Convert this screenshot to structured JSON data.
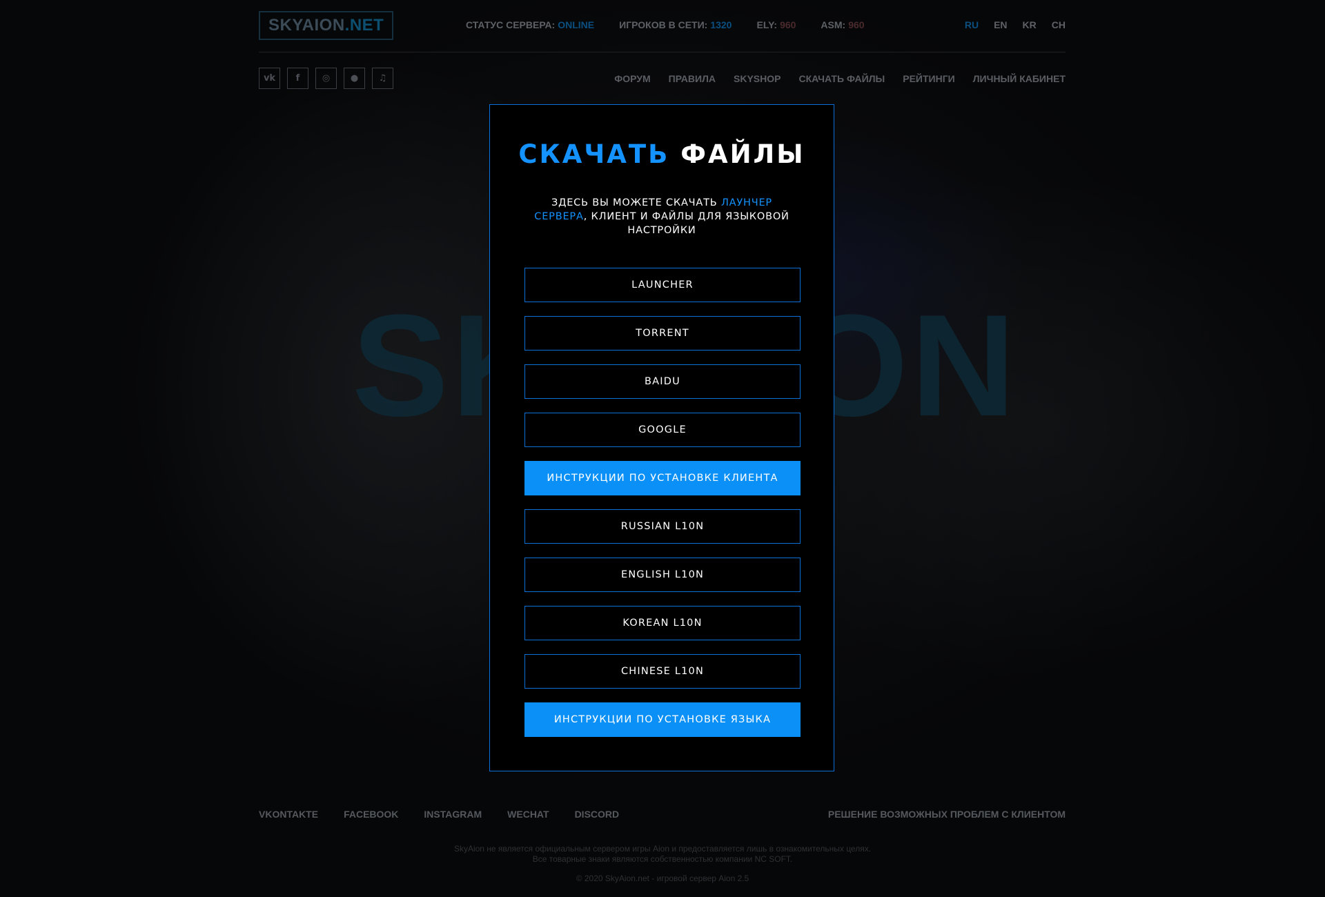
{
  "header": {
    "logo": {
      "main": "SKYAION",
      "suffix": ".NET"
    },
    "stats": [
      {
        "label": "СТАТУС СЕРВЕРА:",
        "value": "ONLINE"
      },
      {
        "label": "ИГРОКОВ В СЕТИ:",
        "value": "1320"
      },
      {
        "label": "ELY:",
        "value": "960"
      },
      {
        "label": "ASM:",
        "value": "960"
      }
    ],
    "languages": [
      "RU",
      "EN",
      "KR",
      "CH"
    ],
    "active_language": "RU"
  },
  "social_icons": [
    "vk-icon",
    "facebook-icon",
    "instagram-icon",
    "wechat-icon",
    "discord-icon"
  ],
  "social_glyphs": [
    "vk",
    "f",
    "◎",
    "●",
    "♫"
  ],
  "nav": [
    "ФОРУМ",
    "ПРАВИЛА",
    "SKYSHOP",
    "СКАЧАТЬ ФАЙЛЫ",
    "РЕЙТИНГИ",
    "ЛИЧНЫЙ КАБИНЕТ"
  ],
  "background_logo": "SKYAION",
  "modal": {
    "title_accent": "СКАЧАТЬ",
    "title_rest": "ФАЙЛЫ",
    "desc_before": "ЗДЕСЬ ВЫ МОЖЕТЕ СКАЧАТЬ ",
    "desc_link": "ЛАУНЧЕР СЕРВЕРА",
    "desc_after": ", КЛИЕНТ И ФАЙЛЫ ДЛЯ ЯЗЫКОВОЙ НАСТРОЙКИ",
    "buttons": [
      {
        "label": "LAUNCHER",
        "primary": false
      },
      {
        "label": "TORRENT",
        "primary": false
      },
      {
        "label": "BAIDU",
        "primary": false
      },
      {
        "label": "GOOGLE",
        "primary": false
      },
      {
        "label": "ИНСТРУКЦИИ ПО УСТАНОВКЕ КЛИЕНТА",
        "primary": true
      },
      {
        "label": "RUSSIAN L10N",
        "primary": false
      },
      {
        "label": "ENGLISH L10N",
        "primary": false
      },
      {
        "label": "KOREAN L10N",
        "primary": false
      },
      {
        "label": "CHINESE L10N",
        "primary": false
      },
      {
        "label": "ИНСТРУКЦИИ ПО УСТАНОВКЕ ЯЗЫКА",
        "primary": true
      }
    ]
  },
  "footer": {
    "links": [
      "VKONTAKTE",
      "FACEBOOK",
      "INSTAGRAM",
      "WECHAT",
      "DISCORD"
    ],
    "right_link": "РЕШЕНИЕ ВОЗМОЖНЫХ ПРОБЛЕМ С КЛИЕНТОМ",
    "disclaimer_line1": "SkyAion не является официальным сервером игры Aion и предоставляется лишь в ознакомительных целях.",
    "disclaimer_line2": "Все товарные знаки являются собственностью компании NC SOFT.",
    "copyright": "© 2020 SkyAion.net - игровой сервер Aion 2.5"
  },
  "colors": {
    "accent": "#1492ff",
    "button_fill": "#0a90f7",
    "border": "#0d70d8"
  }
}
